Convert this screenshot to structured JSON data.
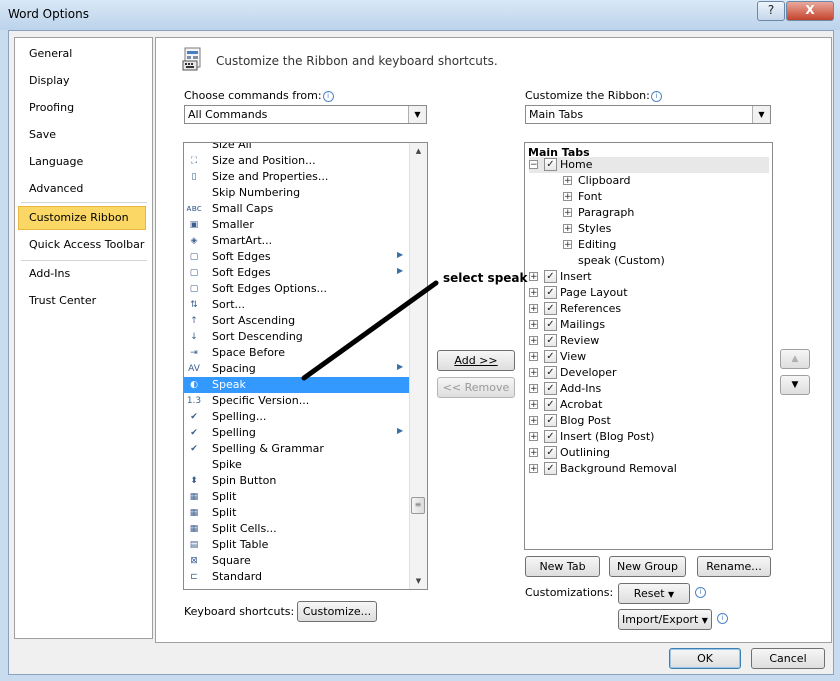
{
  "window": {
    "title": "Word Options"
  },
  "titlebar_buttons": {
    "help": "?",
    "close": "X"
  },
  "nav": {
    "items": [
      "General",
      "Display",
      "Proofing",
      "Save",
      "Language",
      "Advanced",
      "Customize Ribbon",
      "Quick Access Toolbar",
      "Add-Ins",
      "Trust Center"
    ],
    "selected": "Customize Ribbon"
  },
  "main": {
    "heading": "Customize the Ribbon and keyboard shortcuts.",
    "choose_label": "Choose commands from:",
    "choose_value": "All Commands",
    "customize_label": "Customize the Ribbon:",
    "customize_value": "Main Tabs"
  },
  "commands": [
    {
      "label": "Size All",
      "icon": "",
      "submenu": false
    },
    {
      "label": "Size and Position...",
      "icon": "size-position-icon",
      "submenu": false
    },
    {
      "label": "Size and Properties...",
      "icon": "size-properties-icon",
      "submenu": false
    },
    {
      "label": "Skip Numbering",
      "icon": "",
      "submenu": false
    },
    {
      "label": "Small Caps",
      "icon": "small-caps-icon",
      "submenu": false
    },
    {
      "label": "Smaller",
      "icon": "smaller-icon",
      "submenu": false
    },
    {
      "label": "SmartArt...",
      "icon": "smartart-icon",
      "submenu": false
    },
    {
      "label": "Soft Edges",
      "icon": "soft-edges-icon",
      "submenu": true
    },
    {
      "label": "Soft Edges",
      "icon": "soft-edges-icon",
      "submenu": true
    },
    {
      "label": "Soft Edges Options...",
      "icon": "soft-edges-options-icon",
      "submenu": false
    },
    {
      "label": "Sort...",
      "icon": "sort-icon",
      "submenu": false
    },
    {
      "label": "Sort Ascending",
      "icon": "sort-ascending-icon",
      "submenu": false
    },
    {
      "label": "Sort Descending",
      "icon": "sort-descending-icon",
      "submenu": false
    },
    {
      "label": "Space Before",
      "icon": "space-before-icon",
      "submenu": false
    },
    {
      "label": "Spacing",
      "icon": "spacing-icon",
      "submenu": true
    },
    {
      "label": "Speak",
      "icon": "speak-icon",
      "submenu": false,
      "selected": true
    },
    {
      "label": "Specific Version...",
      "icon": "specific-version-icon",
      "submenu": false
    },
    {
      "label": "Spelling...",
      "icon": "spelling-icon",
      "submenu": false
    },
    {
      "label": "Spelling",
      "icon": "spelling-icon",
      "submenu": true
    },
    {
      "label": "Spelling & Grammar",
      "icon": "spelling-grammar-icon",
      "submenu": false
    },
    {
      "label": "Spike",
      "icon": "",
      "submenu": false
    },
    {
      "label": "Spin Button",
      "icon": "spin-button-icon",
      "submenu": false
    },
    {
      "label": "Split",
      "icon": "split-icon",
      "submenu": false
    },
    {
      "label": "Split",
      "icon": "split-icon",
      "submenu": false
    },
    {
      "label": "Split Cells...",
      "icon": "split-cells-icon",
      "submenu": false
    },
    {
      "label": "Split Table",
      "icon": "split-table-icon",
      "submenu": false
    },
    {
      "label": "Square",
      "icon": "square-icon",
      "submenu": false
    },
    {
      "label": "Standard",
      "icon": "standard-icon",
      "submenu": false
    }
  ],
  "tree": {
    "header": "Main Tabs",
    "rows": [
      {
        "label": "Home",
        "level": 0,
        "expander": "−",
        "checked": true,
        "highlight": true
      },
      {
        "label": "Clipboard",
        "level": 1,
        "expander": "+",
        "checked": null
      },
      {
        "label": "Font",
        "level": 1,
        "expander": "+",
        "checked": null
      },
      {
        "label": "Paragraph",
        "level": 1,
        "expander": "+",
        "checked": null
      },
      {
        "label": "Styles",
        "level": 1,
        "expander": "+",
        "checked": null
      },
      {
        "label": "Editing",
        "level": 1,
        "expander": "+",
        "checked": null
      },
      {
        "label": "speak (Custom)",
        "level": 1,
        "expander": "",
        "checked": null
      },
      {
        "label": "Insert",
        "level": 0,
        "expander": "+",
        "checked": true
      },
      {
        "label": "Page Layout",
        "level": 0,
        "expander": "+",
        "checked": true
      },
      {
        "label": "References",
        "level": 0,
        "expander": "+",
        "checked": true
      },
      {
        "label": "Mailings",
        "level": 0,
        "expander": "+",
        "checked": true
      },
      {
        "label": "Review",
        "level": 0,
        "expander": "+",
        "checked": true
      },
      {
        "label": "View",
        "level": 0,
        "expander": "+",
        "checked": true
      },
      {
        "label": "Developer",
        "level": 0,
        "expander": "+",
        "checked": true
      },
      {
        "label": "Add-Ins",
        "level": 0,
        "expander": "+",
        "checked": true
      },
      {
        "label": "Acrobat",
        "level": 0,
        "expander": "+",
        "checked": true
      },
      {
        "label": "Blog Post",
        "level": 0,
        "expander": "+",
        "checked": true
      },
      {
        "label": "Insert (Blog Post)",
        "level": 0,
        "expander": "+",
        "checked": true
      },
      {
        "label": "Outlining",
        "level": 0,
        "expander": "+",
        "checked": true
      },
      {
        "label": "Background Removal",
        "level": 0,
        "expander": "+",
        "checked": true
      }
    ]
  },
  "buttons": {
    "add": "Add >>",
    "remove": "<< Remove",
    "new_tab": "New Tab",
    "new_group": "New Group",
    "rename": "Rename...",
    "reset": "Reset",
    "import_export": "Import/Export",
    "customize": "Customize...",
    "ok": "OK",
    "cancel": "Cancel"
  },
  "labels": {
    "keyboard_shortcuts": "Keyboard shortcuts:",
    "customizations": "Customizations:"
  },
  "annotation": {
    "text": "select speak"
  },
  "colors": {
    "selection": "#3399ff",
    "nav_selected": "#fbd866",
    "annotation_line": "#000000"
  }
}
